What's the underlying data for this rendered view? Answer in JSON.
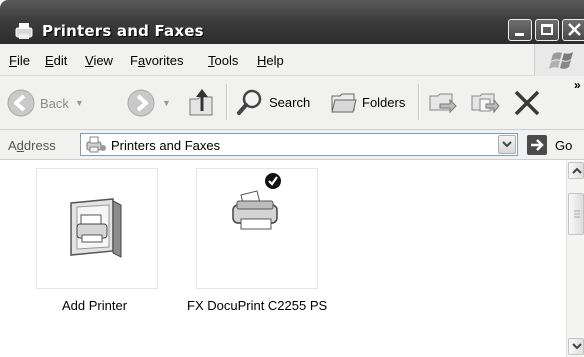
{
  "window": {
    "title": "Printers and Faxes"
  },
  "menu": {
    "items": [
      {
        "mnemonic": "F",
        "rest": "ile"
      },
      {
        "mnemonic": "E",
        "rest": "dit"
      },
      {
        "mnemonic": "V",
        "rest": "iew"
      },
      {
        "pre": "F",
        "mnemonic": "a",
        "rest": "vorites"
      },
      {
        "mnemonic": "T",
        "rest": "ools"
      },
      {
        "mnemonic": "H",
        "rest": "elp"
      }
    ]
  },
  "toolbar": {
    "back_label": "Back",
    "search_label": "Search",
    "folders_label": "Folders",
    "chevron": "»"
  },
  "address": {
    "label_pre": "A",
    "label_mnemonic": "d",
    "label_rest": "dress",
    "value": "Printers and Faxes",
    "go_label": "Go"
  },
  "items": [
    {
      "label": "Add Printer",
      "icon": "add-printer-icon"
    },
    {
      "label": "FX DocuPrint C2255 PS",
      "icon": "default-printer-icon"
    }
  ]
}
